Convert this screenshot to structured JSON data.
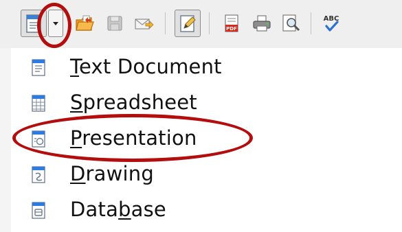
{
  "toolbar": {
    "buttons": [
      {
        "name": "new-document-icon"
      },
      {
        "name": "new-dropdown-arrow"
      },
      {
        "name": "open-folder-icon"
      },
      {
        "name": "save-icon"
      },
      {
        "name": "email-icon"
      },
      {
        "name": "edit-mode-icon"
      },
      {
        "name": "export-pdf-icon"
      },
      {
        "name": "print-icon"
      },
      {
        "name": "print-preview-icon"
      },
      {
        "name": "spellcheck-icon"
      }
    ],
    "pdf_badge": "PDF",
    "spell_badge": "ABC"
  },
  "menu": {
    "items": [
      {
        "before": "",
        "mnemonic": "T",
        "after": "ext Document",
        "icon": "text-document-icon"
      },
      {
        "before": "",
        "mnemonic": "S",
        "after": "preadsheet",
        "icon": "spreadsheet-icon"
      },
      {
        "before": "",
        "mnemonic": "P",
        "after": "resentation",
        "icon": "presentation-icon"
      },
      {
        "before": "",
        "mnemonic": "D",
        "after": "rawing",
        "icon": "drawing-icon"
      },
      {
        "before": "Data",
        "mnemonic": "b",
        "after": "ase",
        "icon": "database-icon"
      }
    ]
  },
  "annotation_color": "#b30d0d"
}
